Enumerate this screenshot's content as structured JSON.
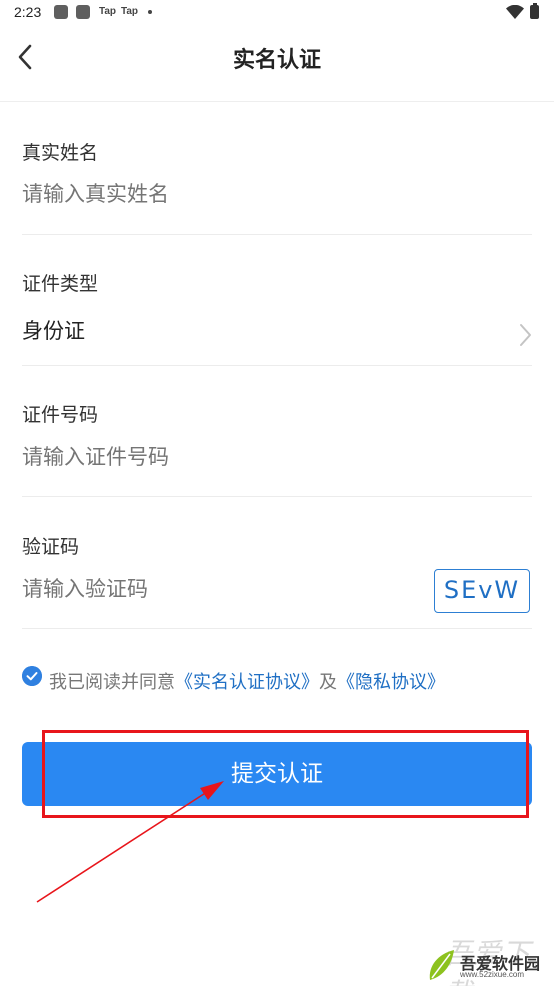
{
  "status_bar": {
    "time": "2:23",
    "tap_1": "Tap",
    "tap_2": "Tap",
    "wifi_icon": "wifi-icon",
    "battery_icon": "battery-icon"
  },
  "header": {
    "back_icon": "chevron-left-icon",
    "title": "实名认证"
  },
  "form": {
    "name": {
      "label": "真实姓名",
      "placeholder": "请输入真实姓名",
      "value": ""
    },
    "id_type": {
      "label": "证件类型",
      "value": "身份证",
      "icon": "chevron-right-icon"
    },
    "id_number": {
      "label": "证件号码",
      "placeholder": "请输入证件号码",
      "value": ""
    },
    "captcha": {
      "label": "验证码",
      "placeholder": "请输入验证码",
      "value": "",
      "image_text": "SEvW"
    }
  },
  "agreement": {
    "checked": true,
    "prefix": "我已阅读并同意",
    "link_1": "《实名认证协议》",
    "connector": "及",
    "link_2": "《隐私协议》"
  },
  "submit": {
    "label": "提交认证"
  },
  "annotation": {
    "color": "#e8151b"
  },
  "watermark": {
    "script": "吾爱下载",
    "text": "吾爱软件园",
    "url": "www.52zixue.com"
  },
  "colors": {
    "accent": "#2a88f2",
    "link": "#1f6fc4",
    "annotation": "#e8151b"
  }
}
